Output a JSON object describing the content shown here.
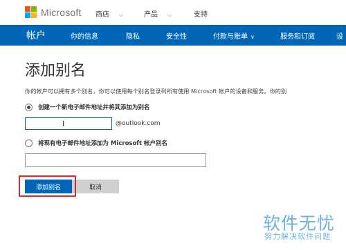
{
  "brand": {
    "name": "Microsoft"
  },
  "topnav": {
    "items": [
      {
        "label": "商店",
        "dropdown": true
      },
      {
        "label": "产品",
        "dropdown": true
      },
      {
        "label": "支持",
        "dropdown": false
      }
    ]
  },
  "accountnav": {
    "account_label": "帐户",
    "items": [
      {
        "label": "你的信息"
      },
      {
        "label": "隐私"
      },
      {
        "label": "安全性"
      },
      {
        "label": "付款与账单",
        "dropdown": true
      },
      {
        "label": "服务和订阅"
      },
      {
        "label": "设"
      }
    ]
  },
  "page": {
    "title": "添加别名",
    "description": "你的帐户可以拥有多个别名，你可以使用每个别名登录到所有使用 Microsoft 帐户的设备和服务。你的别"
  },
  "form": {
    "option_new": {
      "label": "创建一个新电子邮件地址并将其添加为别名",
      "selected": true
    },
    "new_email": {
      "value": "",
      "suffix": "@outlook.com"
    },
    "option_existing": {
      "label": "将现有电子邮件地址添加为 Microsoft 帐户别名",
      "selected": false
    },
    "existing_email": {
      "value": ""
    },
    "submit_label": "添加别名",
    "cancel_label": "取消"
  },
  "watermark": {
    "line1": "软件无忧",
    "line2": "努力解决软件问题"
  },
  "colors": {
    "accent": "#0067b8",
    "highlight": "#e0262a"
  }
}
